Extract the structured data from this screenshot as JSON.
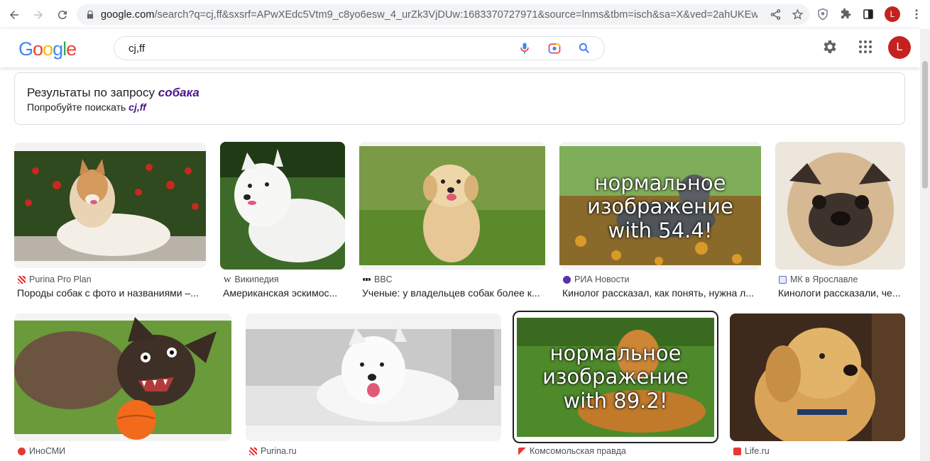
{
  "browser": {
    "url_domain": "google.com",
    "url_rest": "/search?q=cj,ff&sxsrf=APwXEdc5Vtm9_c8yo6esw_4_urZk3VjDUw:1683370727971&source=lnms&tbm=isch&sa=X&ved=2ahUKEwjIg...",
    "profile_initial": "L"
  },
  "header": {
    "logo": [
      "G",
      "o",
      "o",
      "g",
      "l",
      "e"
    ],
    "query": "cj,ff",
    "avatar_initial": "L"
  },
  "spelling": {
    "results_for_prefix": "Результаты по запросу",
    "corrected_query": "собака",
    "try_prefix": "Попробуйте поискать",
    "original_query": "cj,ff"
  },
  "results": [
    {
      "source": "Purina Pro Plan",
      "title": "Породы собак с фото и названиями –..."
    },
    {
      "source": "Википедия",
      "title": "Американская эскимос..."
    },
    {
      "source": "BBC",
      "title": "Ученые: у владельцев собак более к..."
    },
    {
      "source": "РИА Новости",
      "title": "Кинолог рассказал, как понять, нужна л...",
      "overlay": [
        "нормальное",
        "изображение",
        "with 54.4!"
      ]
    },
    {
      "source": "МК в Ярославле",
      "title": "Кинологи рассказали, че..."
    },
    {
      "source": "ИноСМИ",
      "title": ""
    },
    {
      "source": "Purina.ru",
      "title": ""
    },
    {
      "source": "Комсомольская правда",
      "title": "",
      "overlay": [
        "нормальное",
        "изображение",
        "with 89.2!"
      ]
    },
    {
      "source": "Life.ru",
      "title": ""
    }
  ],
  "colors": {
    "google_blue": "#4285f4",
    "google_red": "#ea4335",
    "google_yellow": "#fbbc05",
    "google_green": "#34a853",
    "spell_link": "#4a148c"
  }
}
